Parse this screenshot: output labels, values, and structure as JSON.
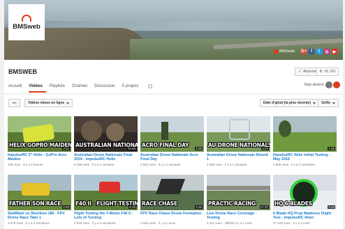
{
  "banner": {
    "logo_text": "BMSweb",
    "site_label": "BMSweb",
    "social": [
      {
        "name": "gplus-icon",
        "glyph": "G+",
        "color": "#dd4b39"
      },
      {
        "name": "facebook-icon",
        "glyph": "f",
        "color": "#3b5998"
      },
      {
        "name": "twitter-icon",
        "glyph": "t",
        "color": "#1da1f2"
      },
      {
        "name": "instagram-icon",
        "glyph": "◎",
        "color": "#c13584"
      },
      {
        "name": "youtube-icon",
        "glyph": "▶",
        "color": "#e52d27"
      }
    ]
  },
  "channel": {
    "title": "BMSWEB",
    "subscribe_label": "Abonné",
    "subscriber_count": "25 291",
    "subscribed_text": "Déjà abonné"
  },
  "tabs": [
    {
      "label": "Accueil",
      "active": false
    },
    {
      "label": "Vidéos",
      "active": true
    },
    {
      "label": "Playlists",
      "active": false
    },
    {
      "label": "Chaînes",
      "active": false
    },
    {
      "label": "Discussion",
      "active": false
    },
    {
      "label": "À propos",
      "active": false
    }
  ],
  "toolbar": {
    "back_glyph": "↤",
    "filter_label": "Vidéos mises en ligne",
    "sort_label": "Date d'ajout (la plus récente)",
    "view_label": "Grille"
  },
  "videos": [
    {
      "overlay": "HELIX GOPRO MAIDEN",
      "duration": "3:21",
      "title": "ImpulseRC 5\" Helix - GoPro Acro Maiden",
      "meta": "448 vues · Il y a 3 heures",
      "sky": "#9bbf7a",
      "ground": "#5a7a32"
    },
    {
      "overlay": "AUSTRALIAN NATIONALS",
      "duration": "10:28",
      "title": "Australian Drone Nationals Final 2016 - impulseRC Helix",
      "meta": "6 189 vues · Il y a 1 semaine",
      "sky": "#4a4038",
      "ground": "#2f2a25"
    },
    {
      "overlay": "ACRO FINAL DAY",
      "duration": "3:05",
      "title": "Australian Drone Nationals Acro Final Day",
      "meta": "3 502 vues · Il y a 1 semaine",
      "sky": "#c9d6dc",
      "ground": "#6d8f48"
    },
    {
      "overlay": "AU DRONE NATIONALS",
      "duration": "3:27",
      "title": "Australian Drone Nationals Round 1",
      "meta": "4 035 vues · Il y a 1 semaine",
      "sky": "#dfe6ea",
      "ground": "#7a9a5c"
    },
    {
      "overlay": "",
      "duration": "1:36",
      "title": "ImpulseRC Helix Initial Testing - May 2016",
      "meta": "2 595 vues · Il y a 2 semaines",
      "sky": "#aebfc6",
      "ground": "#6f9a3e"
    },
    {
      "overlay": "FATHER SON RACE",
      "duration": "4:02",
      "title": "SkidMark vs Shuriken 180 - FPV Drone Race Take 1",
      "meta": "3 076 vues · Il y a 3 semaines",
      "sky": "#a7bcc7",
      "ground": "#6a8a3e"
    },
    {
      "overlay": "F40 II - FLIGHT TESTING",
      "duration": "6:19",
      "title": "Flight Testing the T-Motor F40 II - Lots of Turning",
      "meta": "2 629 vues · Il y a 3 semaines",
      "sky": "#b0c8d6",
      "ground": "#5c7d36"
    },
    {
      "overlay": "RACE CHASE",
      "duration": "2:25",
      "title": "FPV Race Chase Drone Formation",
      "meta": "3 502 vues · Il y a 1 mois",
      "sky": "#c4ccd0",
      "ground": "#55704a"
    },
    {
      "overlay": "PRACTIC RACING",
      "duration": "17:37",
      "title": "Live Drone Race Coverage - Testing",
      "meta": "3 211 vues · Diffusé il y a 1 mois",
      "sky": "#c8d2d6",
      "ground": "#6f8656"
    },
    {
      "overlay": "HQ 6 BLADES",
      "duration": "9:48",
      "title": "6 Blade HQ Prop Madness Flight Test - impulseRC Alien",
      "meta": "27 045 vues · Il y a 1 mois",
      "sky": "#d9dee6",
      "ground": "#eaeef2"
    }
  ]
}
